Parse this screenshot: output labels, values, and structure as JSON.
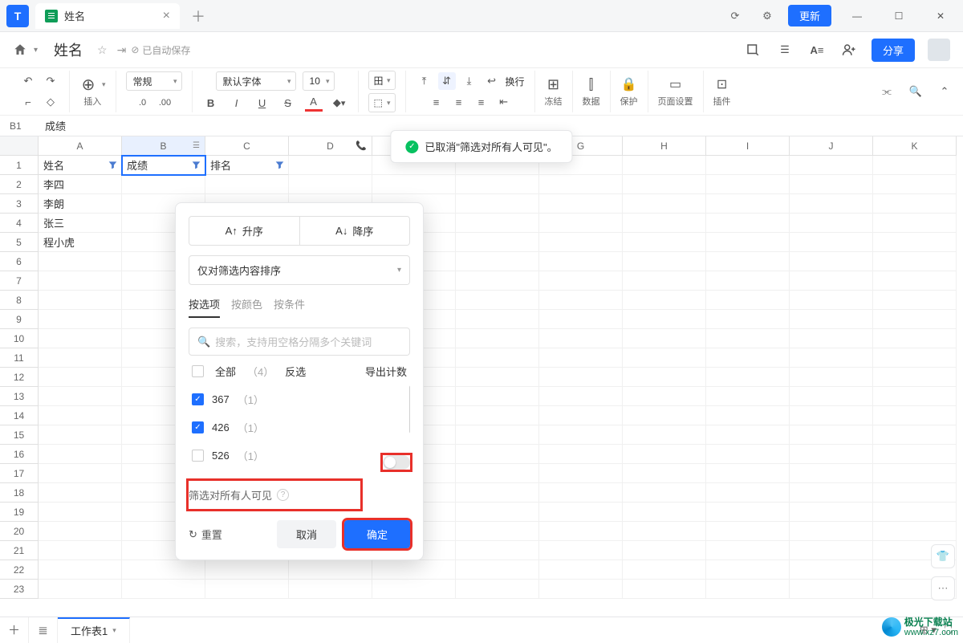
{
  "titlebar": {
    "tab_title": "姓名",
    "update": "更新"
  },
  "docbar": {
    "title": "姓名",
    "autosave": "已自动保存",
    "share": "分享"
  },
  "toolbar": {
    "insert": "插入",
    "format_general": "常规",
    "decimals": ".0",
    "decimals2": ".00",
    "font": "默认字体",
    "size": "10",
    "wrap": "换行",
    "freeze": "冻结",
    "data": "数据",
    "protect": "保护",
    "page": "页面设置",
    "plugin": "插件"
  },
  "formula": {
    "ref": "B1",
    "value": "成绩"
  },
  "cols": [
    "A",
    "B",
    "C",
    "D",
    "E",
    "F",
    "G",
    "H",
    "I",
    "J",
    "K"
  ],
  "data_rows": [
    {
      "n": 1,
      "A": "姓名",
      "B": "成绩",
      "C": "排名"
    },
    {
      "n": 2,
      "A": "李四"
    },
    {
      "n": 3,
      "A": "李朗"
    },
    {
      "n": 4,
      "A": "张三"
    },
    {
      "n": 5,
      "A": "程小虎"
    }
  ],
  "toast": "已取消\"筛选对所有人可见\"。",
  "filter": {
    "asc": "升序",
    "desc": "降序",
    "scope": "仅对筛选内容排序",
    "tabs": [
      "按选项",
      "按颜色",
      "按条件"
    ],
    "search_ph": "搜索，支持用空格分隔多个关键词",
    "all": "全部",
    "all_count": "（4）",
    "invert": "反选",
    "export": "导出计数",
    "items": [
      {
        "v": "367",
        "c": "（1）",
        "on": true
      },
      {
        "v": "426",
        "c": "（1）",
        "on": true
      },
      {
        "v": "526",
        "c": "（1）",
        "on": false
      }
    ],
    "visible_all": "筛选对所有人可见",
    "reset": "重置",
    "cancel": "取消",
    "ok": "确定"
  },
  "sheet": {
    "name": "工作表1"
  },
  "watermark": {
    "a": "极光下载站",
    "b": "www.xz7.com"
  }
}
